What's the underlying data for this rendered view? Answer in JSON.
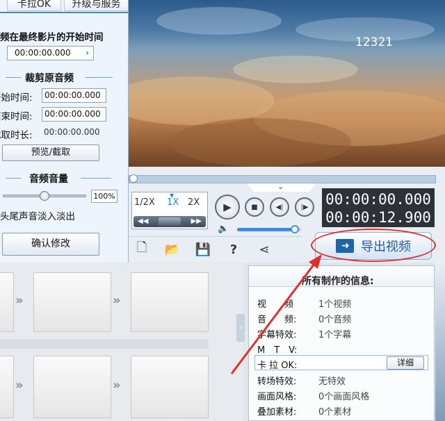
{
  "left_panel": {
    "tab_karaoke": "卡拉OK",
    "tab_upgrade": "升级与服务",
    "start_time_label": "频在最终影片的开始时间",
    "start_time_value": "00:00:00.000",
    "crop_section_title": "裁剪原音频",
    "crop_start_label": "开始时间:",
    "crop_start_value": "00:00:00.000",
    "crop_end_label": "结束时间:",
    "crop_end_value": "00:00:00.000",
    "crop_duration_label": "截取时长:",
    "crop_duration_value": "00:00:00.000",
    "preview_button": "预览/截取",
    "volume_section_title": "音频音量",
    "volume_value": "100%",
    "volume_fraction": 0.5,
    "fade_label": "头尾声音淡入淡出",
    "confirm_button": "确认修改"
  },
  "video": {
    "overlay_text": "12321"
  },
  "controls": {
    "speed_half": "1/2X",
    "speed_1x": "1X",
    "speed_2x": "2X",
    "current_time": "00:00:00.000",
    "total_time": "00:00:12.900",
    "volume_fraction": 0.9,
    "timeline_position": 0
  },
  "toolbar": {
    "export_label": "导出视频"
  },
  "info_panel": {
    "title": "所有制作的信息:",
    "video_label": "视　　频",
    "video_value": "1个视频",
    "audio_label": "音　　频:",
    "audio_value": "0个音频",
    "subtitle_label": "字幕特效:",
    "subtitle_value": "1个字幕",
    "mtv_label": "M　T　V:",
    "karaoke_label": "卡 拉 OK:",
    "detail_button": "详细",
    "transition_label": "转场特效:",
    "transition_value": "无特效",
    "style_label": "画面风格:",
    "style_value": "0个画面风格",
    "overlay_label": "叠加素材:",
    "overlay_value": "0个素材"
  },
  "colors": {
    "accent": "#1e5c98",
    "annotation": "#e0302a"
  }
}
